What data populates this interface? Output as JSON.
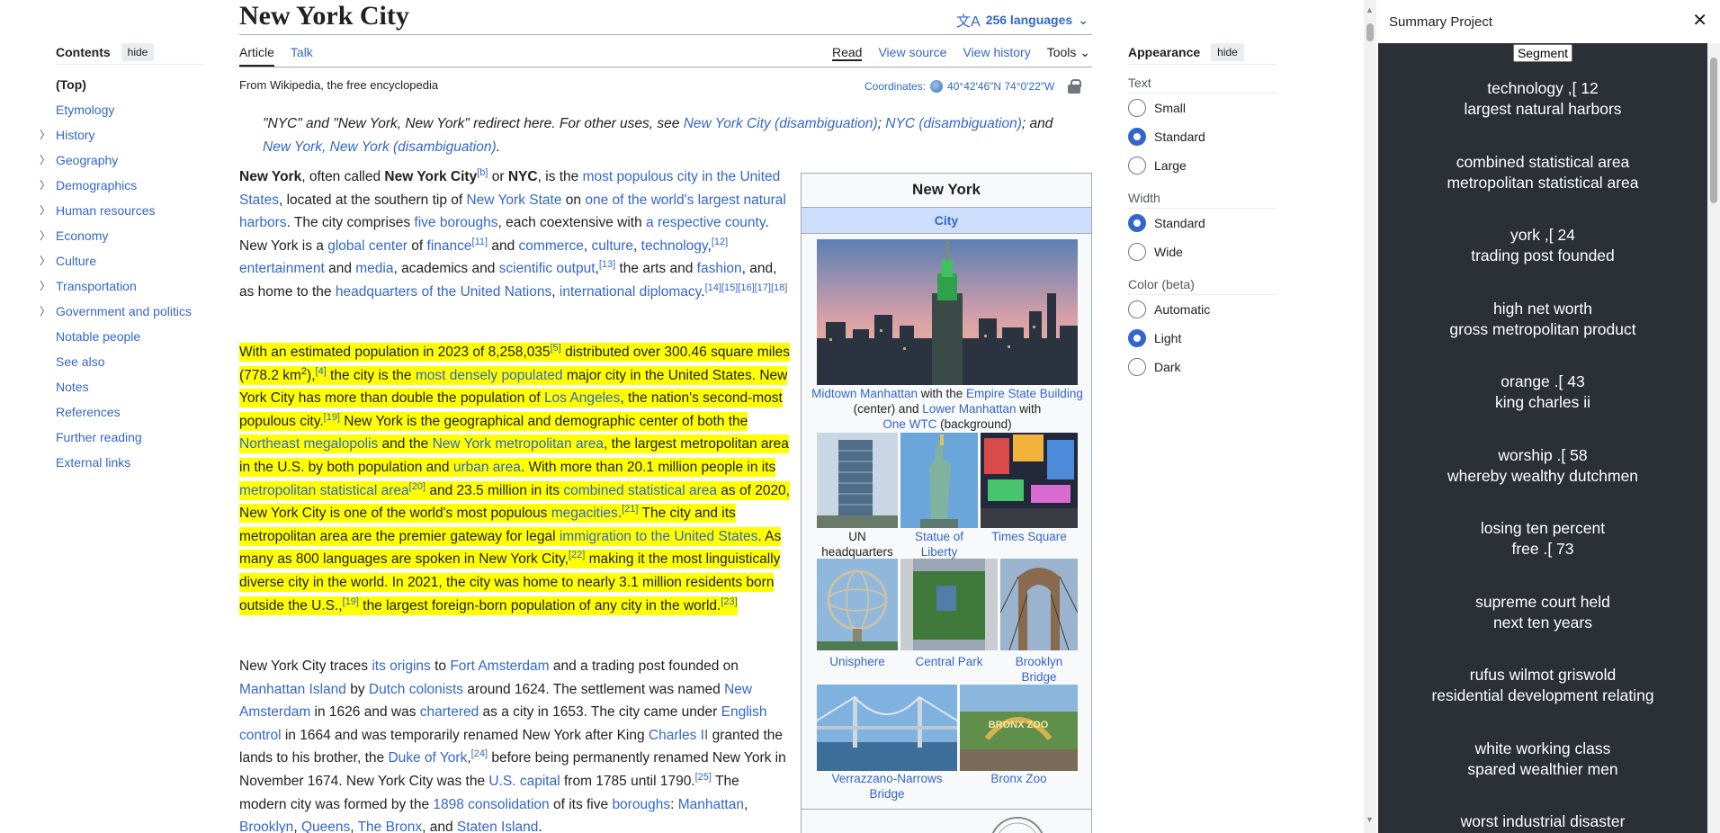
{
  "article": {
    "title": "New York City",
    "languages": "256 languages",
    "tabs_left": [
      "Article",
      "Talk"
    ],
    "tabs_right": [
      "Read",
      "View source",
      "View history",
      "Tools"
    ],
    "from_wikipedia": "From Wikipedia, the free encyclopedia",
    "coordinates_label": "Coordinates:",
    "coordinates_value": "40°42′46″N 74°0′22″W",
    "hatnote": "\"NYC\" and \"New York, New York\" redirect here. For other uses, see ",
    "hatnote_links": [
      "New York City (disambiguation)",
      "NYC (disambiguation)",
      "New York, New York (disambiguation)"
    ],
    "hatnote_and": "and",
    "hatnote_sep": ";"
  },
  "toc": {
    "title": "Contents",
    "hide": "hide",
    "items": [
      {
        "label": "(Top)",
        "expandable": false
      },
      {
        "label": "Etymology",
        "expandable": false
      },
      {
        "label": "History",
        "expandable": true
      },
      {
        "label": "Geography",
        "expandable": true
      },
      {
        "label": "Demographics",
        "expandable": true
      },
      {
        "label": "Human resources",
        "expandable": true
      },
      {
        "label": "Economy",
        "expandable": true
      },
      {
        "label": "Culture",
        "expandable": true
      },
      {
        "label": "Transportation",
        "expandable": true
      },
      {
        "label": "Government and politics",
        "expandable": true
      },
      {
        "label": "Notable people",
        "expandable": false
      },
      {
        "label": "See also",
        "expandable": false
      },
      {
        "label": "Notes",
        "expandable": false
      },
      {
        "label": "References",
        "expandable": false
      },
      {
        "label": "Further reading",
        "expandable": false
      },
      {
        "label": "External links",
        "expandable": false
      }
    ]
  },
  "infobox": {
    "title": "New York",
    "subtitle": "City",
    "main_caption_parts": [
      "Midtown Manhattan",
      " with the ",
      "Empire State Building",
      " (center) and ",
      "Lower Manhattan",
      " with ",
      "One WTC",
      " (background)"
    ],
    "captions": [
      "UN headquarters",
      "Statue of Liberty",
      "Times Square",
      "Unisphere",
      "Central Park",
      "Brooklyn Bridge",
      "Verrazzano-Narrows Bridge",
      "Bronx Zoo"
    ],
    "zoo_sign": "BRONX ZOO"
  },
  "appearance": {
    "title": "Appearance",
    "hide": "hide",
    "text_label": "Text",
    "text_options": [
      "Small",
      "Standard",
      "Large"
    ],
    "text_selected": "Standard",
    "width_label": "Width",
    "width_options": [
      "Standard",
      "Wide"
    ],
    "width_selected": "Standard",
    "color_label": "Color (beta)",
    "color_options": [
      "Automatic",
      "Light",
      "Dark"
    ],
    "color_selected": "Light"
  },
  "panel": {
    "title": "Summary Project",
    "close": "✕",
    "segment_button": "Segment",
    "summaries": [
      [
        "technology ,[ 12",
        "largest natural harbors"
      ],
      [
        "combined statistical area",
        "metropolitan statistical area"
      ],
      [
        "york ,[ 24",
        "trading post founded"
      ],
      [
        "high net worth",
        "gross metropolitan product"
      ],
      [
        "orange .[ 43",
        "king charles ii"
      ],
      [
        "worship .[ 58",
        "whereby wealthy dutchmen"
      ],
      [
        "losing ten percent",
        "free .[ 73"
      ],
      [
        "supreme court held",
        "next ten years"
      ],
      [
        "rufus wilmot griswold",
        "residential development relating"
      ],
      [
        "white working class",
        "spared wealthier men"
      ],
      [
        "worst industrial disaster",
        ""
      ]
    ]
  },
  "colors": {
    "link": "#3366cc",
    "highlight": "#ffff00",
    "panel_bg": "#2b2f36",
    "infobox_header": "#cddffc"
  }
}
